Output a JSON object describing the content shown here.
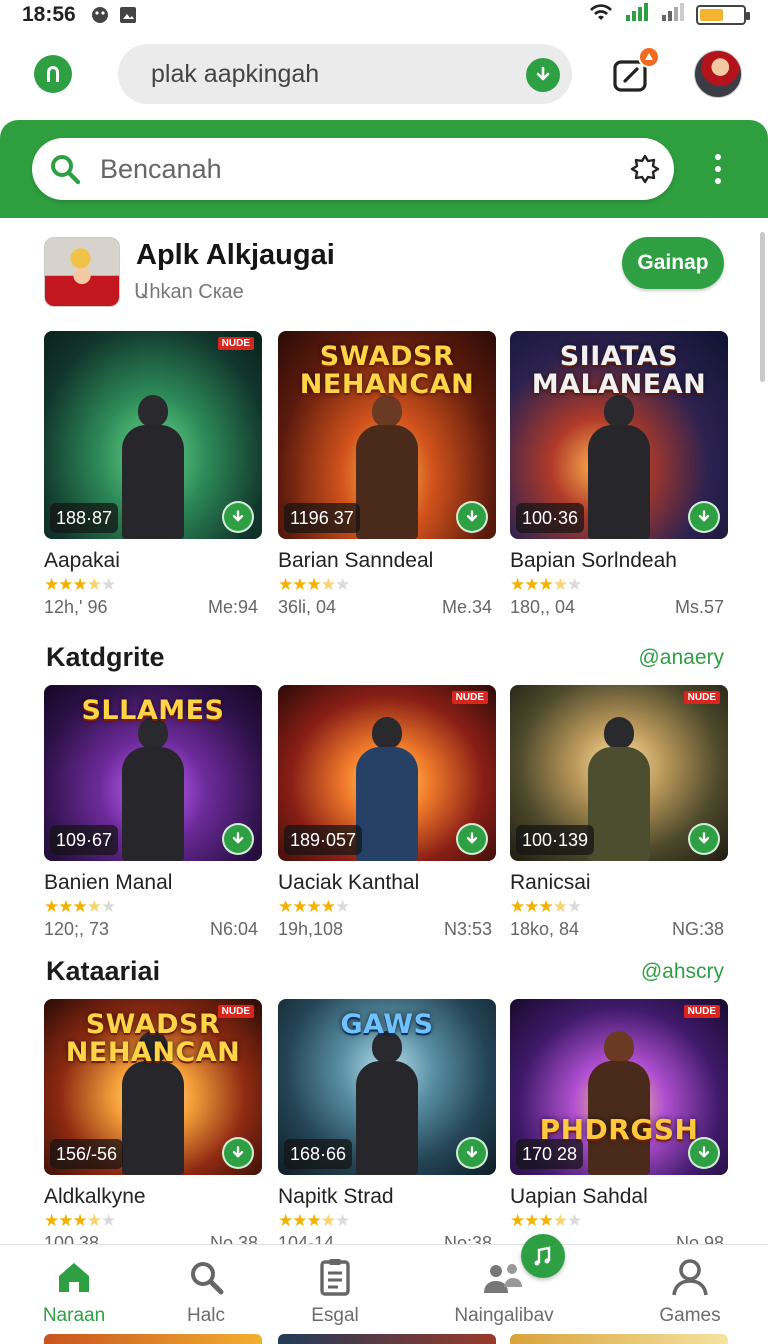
{
  "status_bar": {
    "time": "18:56"
  },
  "top_bar": {
    "url_text": "plak aapkingah"
  },
  "search": {
    "placeholder": "Bencanah"
  },
  "featured_app": {
    "name": "Aplk Alkjaugai",
    "subtitle": "Աhkan Cкae",
    "install_label": "Gainap"
  },
  "tile_badge": "NUDE",
  "sections": [
    {
      "title": "",
      "more": "",
      "tiles": [
        {
          "art": "art-green",
          "overlay": "",
          "count": "188·87",
          "name": "Aapakai",
          "stars": 3.5,
          "meta": "12h,' 96",
          "size": "Me:94",
          "badge": true
        },
        {
          "art": "art-red",
          "overlay": "SWADSR NEHANCAN",
          "count": "1196 37",
          "name": "Barian Sanndeal",
          "stars": 3.5,
          "meta": "36li, 04",
          "size": "Me.34",
          "badge": false
        },
        {
          "art": "art-night",
          "overlay": "SIIATAS MALANEAN",
          "count": "100·36",
          "name": "Bapian Sorlndeah",
          "stars": 3.5,
          "meta": "180,, 04",
          "size": "Ms.57",
          "badge": false
        }
      ]
    },
    {
      "title": "Katdgrite",
      "more": "@anaery",
      "tiles": [
        {
          "art": "art-purple",
          "overlay": "SLLAMES",
          "count": "109·67",
          "name": "Banien Manal",
          "stars": 3.5,
          "meta": "120;, 73",
          "size": "N6:04",
          "badge": false
        },
        {
          "art": "art-fire",
          "overlay": "",
          "count": "189·057",
          "name": "Uaciak Kanthal",
          "stars": 4,
          "meta": "19h,108",
          "size": "N3:53",
          "badge": true
        },
        {
          "art": "art-olive",
          "overlay": "",
          "count": "100·139",
          "name": "Ranicsai",
          "stars": 3.5,
          "meta": "18ko, 84",
          "size": "NG:38",
          "badge": true
        }
      ]
    },
    {
      "title": "Kataariai",
      "more": "@ahscry",
      "tiles": [
        {
          "art": "art-gold",
          "overlay": "SWADSR NEHANCAN",
          "count": "156/-56",
          "name": "Aldkalkyne",
          "stars": 3.5,
          "meta": "100.38",
          "size": "No.38",
          "badge": true
        },
        {
          "art": "art-teal",
          "overlay": "GAWS",
          "count": "168·66",
          "name": "Napitk Strad",
          "stars": 3.5,
          "meta": "104-14",
          "size": "No:38",
          "badge": false
        },
        {
          "art": "art-violet",
          "overlay": "PHDRGSH",
          "count": "170 28",
          "name": "Uapian Sahdal",
          "stars": 3.5,
          "meta": "",
          "size": "No.98",
          "badge": true
        }
      ]
    }
  ],
  "bottom_nav": [
    {
      "label": "Naraan",
      "icon": "home-icon",
      "active": true
    },
    {
      "label": "Halc",
      "icon": "search-icon",
      "active": false
    },
    {
      "label": "Esgal",
      "icon": "document-icon",
      "active": false
    },
    {
      "label": "Naingalibav",
      "icon": "people-icon",
      "active": false
    },
    {
      "label": "Games",
      "icon": "person-icon",
      "active": false
    }
  ],
  "colors": {
    "accent": "#2ea043",
    "band": "#2e9e3f",
    "star": "#f2b000",
    "badge_new": "#d7261e"
  }
}
